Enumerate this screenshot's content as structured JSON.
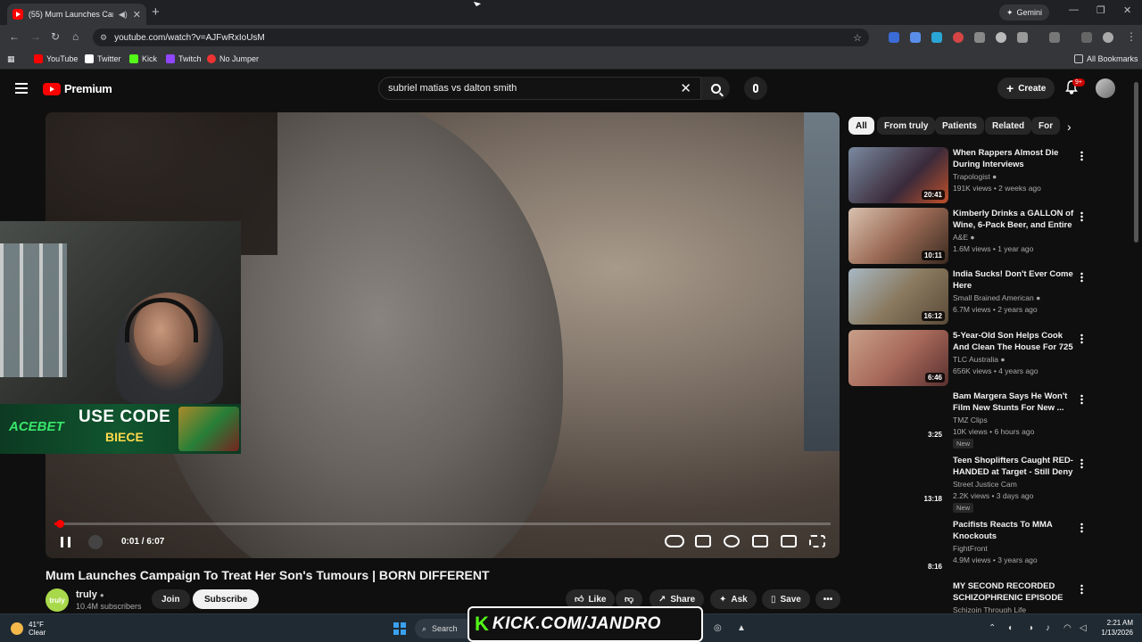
{
  "browser": {
    "tab_title": "(55) Mum Launches Campa",
    "url": "youtube.com/watch?v=AJFwRxIoUsM",
    "gemini_label": "Gemini",
    "bookmarks": [
      "YouTube",
      "Twitter",
      "Kick",
      "Twitch",
      "No Jumper"
    ],
    "all_bookmarks": "All Bookmarks"
  },
  "header": {
    "logo_text": "Premium",
    "search_query": "subriel matias vs dalton smith",
    "create_label": "Create",
    "notifications_badge": "9+"
  },
  "player": {
    "time_display": "0:01 / 6:07",
    "progress_fraction": 0.005
  },
  "overlay": {
    "ad_brand": "ACEBET",
    "ad_line1": "USE CODE",
    "ad_line2": "BIECE",
    "kick_text": "KICK.COM/JANDRO"
  },
  "video": {
    "title": "Mum Launches Campaign To Treat Her Son's Tumours | BORN DIFFERENT",
    "channel": "truly",
    "channel_avatar_text": "truly",
    "subscribers": "10.4M subscribers",
    "join_label": "Join",
    "subscribe_label": "Subscribe",
    "like_label": "Like",
    "share_label": "Share",
    "ask_label": "Ask",
    "save_label": "Save"
  },
  "chips": [
    "All",
    "From truly",
    "Patients",
    "Related",
    "For"
  ],
  "recommendations": [
    {
      "title": "When Rappers Almost Die During Interviews",
      "channel": "Trapologist",
      "meta": "191K views • 2 weeks ago",
      "duration": "20:41",
      "badge": ""
    },
    {
      "title": "Kimberly Drinks a GALLON of Wine, 6-Pack Beer, and Entire ...",
      "channel": "A&E",
      "meta": "1.6M views • 1 year ago",
      "duration": "10:11",
      "badge": ""
    },
    {
      "title": "India Sucks! Don't Ever Come Here",
      "channel": "Small Brained American",
      "meta": "6.7M views • 2 years ago",
      "duration": "16:12",
      "badge": ""
    },
    {
      "title": "5-Year-Old Son Helps Cook And Clean The House For 725 lb ...",
      "channel": "TLC Australia",
      "meta": "656K views • 4 years ago",
      "duration": "6:46",
      "badge": ""
    },
    {
      "title": "Bam Margera Says He Won't Film New Stunts For New ...",
      "channel": "TMZ Clips",
      "meta": "10K views • 6 hours ago",
      "duration": "3:25",
      "badge": "New"
    },
    {
      "title": "Teen Shoplifters Caught RED-HANDED at Target - Still Deny ...",
      "channel": "Street Justice Cam",
      "meta": "2.2K views • 3 days ago",
      "duration": "13:18",
      "badge": "New"
    },
    {
      "title": "Pacifists Reacts To MMA Knockouts",
      "channel": "FightFront",
      "meta": "4.9M views • 3 years ago",
      "duration": "8:16",
      "badge": ""
    },
    {
      "title": "MY SECOND RECORDED SCHIZOPHRENIC EPISODE",
      "channel": "Schizoin Through Life",
      "meta": "",
      "duration": "",
      "badge": ""
    }
  ],
  "taskbar": {
    "temp": "41°F",
    "condition": "Clear",
    "search_label": "Search",
    "time": "2:21 AM",
    "date": "1/13/2026"
  }
}
